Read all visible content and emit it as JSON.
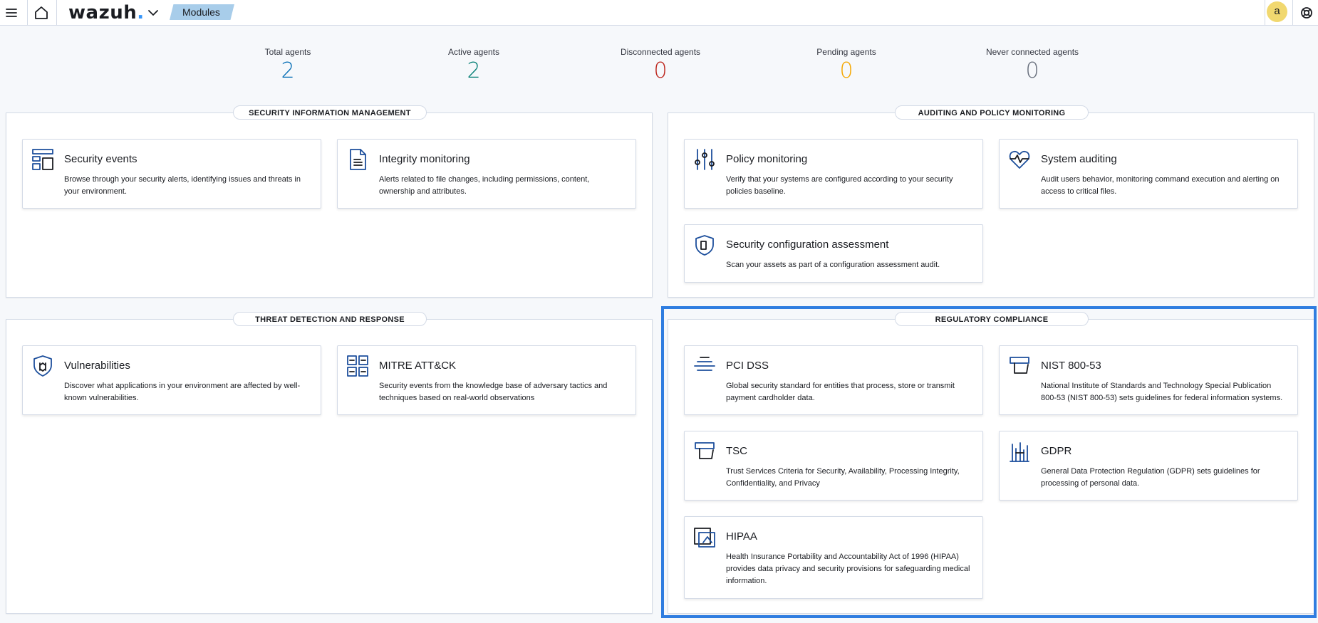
{
  "header": {
    "logo_text": "wazuh",
    "logo_dot": ".",
    "breadcrumb": "Modules",
    "user_initial": "a"
  },
  "stats": [
    {
      "label": "Total agents",
      "value": "2",
      "color": "#006bb4"
    },
    {
      "label": "Active agents",
      "value": "2",
      "color": "#017d73"
    },
    {
      "label": "Disconnected agents",
      "value": "0",
      "color": "#bd271e"
    },
    {
      "label": "Pending agents",
      "value": "0",
      "color": "#f5a700"
    },
    {
      "label": "Never connected agents",
      "value": "0",
      "color": "#69707d"
    }
  ],
  "sections": {
    "security_info": {
      "title": "SECURITY INFORMATION MANAGEMENT",
      "cards": [
        {
          "title": "Security events",
          "icon": "dashboard-icon",
          "description": "Browse through your security alerts, identifying issues and threats in your environment."
        },
        {
          "title": "Integrity monitoring",
          "icon": "document-icon",
          "description": "Alerts related to file changes, including permissions, content, ownership and attributes."
        }
      ]
    },
    "auditing": {
      "title": "AUDITING AND POLICY MONITORING",
      "cards": [
        {
          "title": "Policy monitoring",
          "icon": "sliders-icon",
          "description": "Verify that your systems are configured according to your security policies baseline."
        },
        {
          "title": "System auditing",
          "icon": "heartbeat-icon",
          "description": "Audit users behavior, monitoring command execution and alerting on access to critical files."
        },
        {
          "title": "Security configuration assessment",
          "icon": "shield-doc-icon",
          "description": "Scan your assets as part of a configuration assessment audit."
        }
      ]
    },
    "threat": {
      "title": "THREAT DETECTION AND RESPONSE",
      "cards": [
        {
          "title": "Vulnerabilities",
          "icon": "shield-bug-icon",
          "description": "Discover what applications in your environment are affected by well-known vulnerabilities."
        },
        {
          "title": "MITRE ATT&CK",
          "icon": "grid-icon",
          "description": "Security events from the knowledge base of adversary tactics and techniques based on real-world observations"
        }
      ]
    },
    "compliance": {
      "title": "REGULATORY COMPLIANCE",
      "cards": [
        {
          "title": "PCI DSS",
          "icon": "layers-icon",
          "description": "Global security standard for entities that process, store or transmit payment cardholder data."
        },
        {
          "title": "NIST 800-53",
          "icon": "stamp-icon",
          "description": "National Institute of Standards and Technology Special Publication 800-53 (NIST 800-53) sets guidelines for federal information systems."
        },
        {
          "title": "TSC",
          "icon": "stamp-icon",
          "description": "Trust Services Criteria for Security, Availability, Processing Integrity, Confidentiality, and Privacy"
        },
        {
          "title": "GDPR",
          "icon": "columns-icon",
          "description": "General Data Protection Regulation (GDPR) sets guidelines for processing of personal data."
        },
        {
          "title": "HIPAA",
          "icon": "folders-icon",
          "description": "Health Insurance Portability and Accountability Act of 1996 (HIPAA) provides data privacy and security provisions for safeguarding medical information."
        }
      ]
    }
  }
}
